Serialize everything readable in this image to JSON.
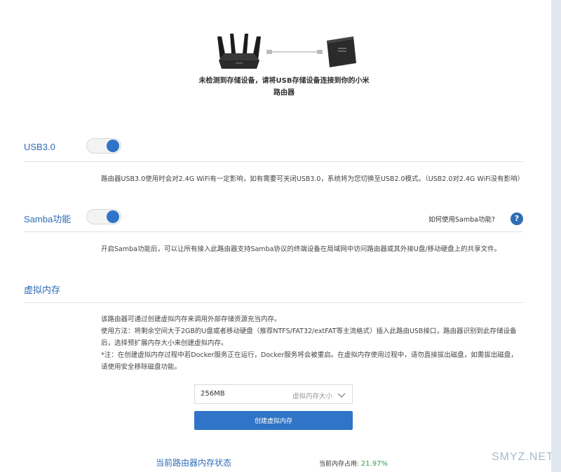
{
  "hero": {
    "message_line1": "未检测到存储设备，请将USB存储设备连接到你的小米",
    "message_line2": "路由器"
  },
  "usb30": {
    "title": "USB3.0",
    "enabled": true,
    "description": "路由器USB3.0使用时会对2.4G WiFi有一定影响，如有需要可关闭USB3.0，系统将为您切换至USB2.0模式。（USB2.0对2.4G WiFi没有影响）"
  },
  "samba": {
    "title": "Samba功能",
    "enabled": true,
    "help_text": "如何使用Samba功能?",
    "help_icon": "?",
    "description": "开启Samba功能后，可以让所有接入此路由器支持Samba协议的终端设备在局域网中访问路由器或其外接U盘/移动硬盘上的共享文件。"
  },
  "virtual_memory": {
    "title": "虚拟内存",
    "intro": "该路由器可通过创建虚拟内存来调用外部存储资源充当内存。",
    "usage_line1": "使用方法：将剩余空间大于2GB的U盘或者移动硬盘（推荐NTFS/FAT32/extFAT等主流格式）插入此路由USB接口，路由器识别到此存储设备",
    "usage_line2": "后，选择预扩展内存大小来创建虚拟内存。",
    "note_line1": "*注：在创建虚拟内存过程中若Docker服务正在运行，Docker服务将会被重启。在虚拟内存使用过程中，请勿直接拔出磁盘，如需拔出磁盘，",
    "note_line2": "请使用安全移除磁盘功能。",
    "size_value": "256MB",
    "size_placeholder": "虚拟内存大小",
    "create_button": "创建虚拟内存"
  },
  "memory_status": {
    "title": "当前路由器内存状态",
    "usage_label": "当前内存占用:",
    "usage_value": "21.97%"
  },
  "watermark": "SMYZ.NET",
  "colors": {
    "accent": "#2f74c6",
    "heading": "#2f6db6",
    "usage_green": "#33a04a"
  }
}
